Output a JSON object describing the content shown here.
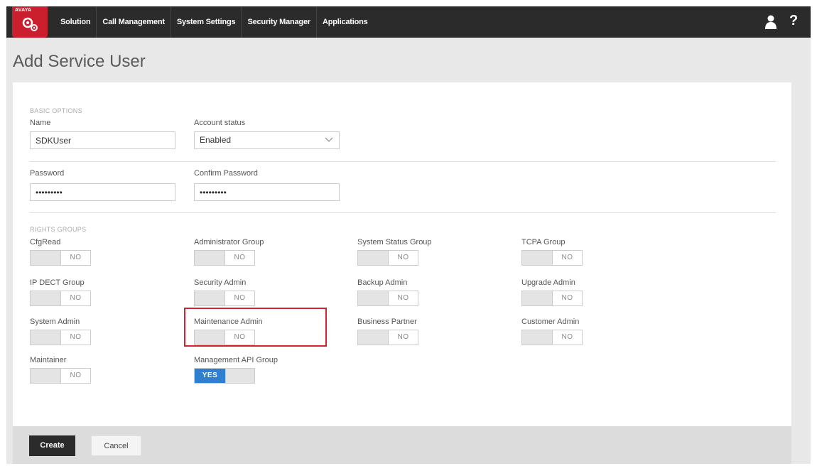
{
  "header": {
    "brand": "AVAYA",
    "nav": [
      "Solution",
      "Call Management",
      "System Settings",
      "Security Manager",
      "Applications"
    ],
    "help": "?"
  },
  "page": {
    "title": "Add Service User"
  },
  "basic": {
    "section": "BASIC OPTIONS",
    "name_label": "Name",
    "name_value": "SDKUser",
    "status_label": "Account status",
    "status_value": "Enabled",
    "password_label": "Password",
    "password_value": "•••••••••",
    "confirm_label": "Confirm Password",
    "confirm_value": "•••••••••"
  },
  "rights": {
    "section": "RIGHTS GROUPS",
    "groups": [
      {
        "label": "CfgRead",
        "state": "NO"
      },
      {
        "label": "Administrator Group",
        "state": "NO"
      },
      {
        "label": "System Status Group",
        "state": "NO"
      },
      {
        "label": "TCPA Group",
        "state": "NO"
      },
      {
        "label": "IP DECT Group",
        "state": "NO"
      },
      {
        "label": "Security Admin",
        "state": "NO"
      },
      {
        "label": "Backup Admin",
        "state": "NO"
      },
      {
        "label": "Upgrade Admin",
        "state": "NO"
      },
      {
        "label": "System Admin",
        "state": "NO"
      },
      {
        "label": "Maintenance Admin",
        "state": "NO"
      },
      {
        "label": "Business Partner",
        "state": "NO"
      },
      {
        "label": "Customer Admin",
        "state": "NO"
      },
      {
        "label": "Maintainer",
        "state": "NO"
      },
      {
        "label": "Management API Group",
        "state": "YES"
      }
    ]
  },
  "footer": {
    "create": "Create",
    "cancel": "Cancel"
  },
  "colors": {
    "brand": "#cc1f2d",
    "toggle_on": "#2f7fd0",
    "highlight": "#d2232e"
  }
}
